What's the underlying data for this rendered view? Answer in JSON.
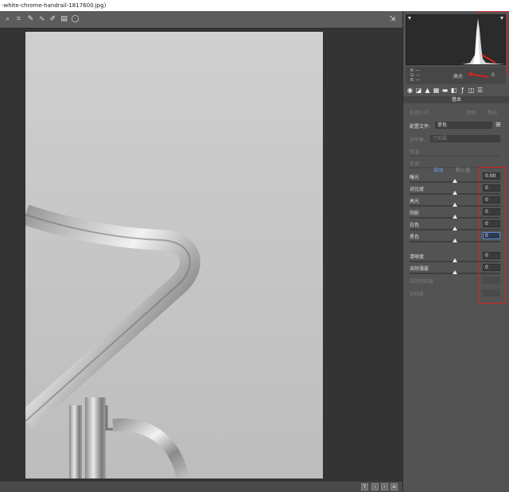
{
  "window": {
    "title": "-white-chrome-handrail-1817600.jpg)"
  },
  "toolbar": {
    "tools": [
      {
        "name": "zoom-tool-icon",
        "glyph": "⌕"
      },
      {
        "name": "crop-tool-icon",
        "glyph": "⌗"
      },
      {
        "name": "spot-removal-icon",
        "glyph": "✎"
      },
      {
        "name": "red-eye-icon",
        "glyph": "∿"
      },
      {
        "name": "brush-icon",
        "glyph": "✐"
      },
      {
        "name": "graduated-filter-icon",
        "glyph": "▤"
      },
      {
        "name": "radial-filter-icon",
        "glyph": "◯"
      }
    ],
    "export_glyph": "⇲"
  },
  "histogram": {
    "readout_label": "高光",
    "readout_value": "0",
    "r_label": "R:",
    "g_label": "G:",
    "b_label": "B:",
    "r_value": "---",
    "g_value": "---",
    "b_value": "---"
  },
  "panel": {
    "section_title": "基本",
    "process_label": "处理方式:",
    "option_color": "颜色",
    "option_bw": "黑白",
    "profile_label": "配置文件:",
    "profile_value": "单色",
    "wb_label": "白平衡:",
    "wb_value": "已拍摄",
    "temp_label": "色温",
    "tint_label": "色调",
    "auto_label": "自动",
    "default_label": "默认值",
    "sliders": [
      {
        "label": "曝光",
        "value": "0.00",
        "position": 0.5
      },
      {
        "label": "对比度",
        "value": "0",
        "position": 0.5
      },
      {
        "label": "高光",
        "value": "0",
        "position": 0.5
      },
      {
        "label": "阴影",
        "value": "0",
        "position": 0.5
      },
      {
        "label": "白色",
        "value": "0",
        "position": 0.5
      },
      {
        "label": "黑色",
        "value": "0",
        "position": 0.5
      },
      {
        "label": "清晰度",
        "value": "0",
        "position": 0.5
      },
      {
        "label": "去除薄雾",
        "value": "0",
        "position": 0.5
      }
    ],
    "vibrance_label": "自然饱和度",
    "saturation_label": "饱和度"
  },
  "statusbar": {
    "buttons": [
      "Y",
      "‹",
      "›",
      "≡"
    ]
  },
  "colors": {
    "accent": "#5a86c8",
    "annotation": "#d42222"
  }
}
